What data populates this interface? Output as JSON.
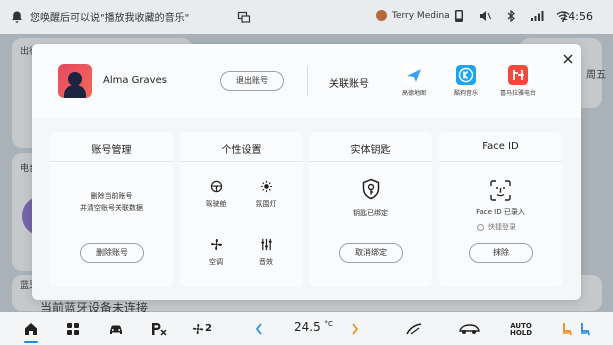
{
  "status_bar": {
    "voice_hint": "您唤醒后可以说\"播放我收藏的音乐\"",
    "user": "Terry Medina",
    "time": "14:56"
  },
  "background": {
    "left_label_1": "出行",
    "left_label_2": "电台",
    "left_label_3": "蓝牙",
    "right_label": "周五",
    "bottom_text": "当前蓝牙设备未连接"
  },
  "dialog": {
    "user_name": "Alma Graves",
    "logout_label": "退出账号",
    "linked_accounts_title": "关联账号",
    "linked_apps": [
      {
        "label": "高德地图",
        "icon": "amap-icon",
        "color": "#3aa0f0"
      },
      {
        "label": "酷狗音乐",
        "icon": "kugou-icon",
        "color": "#1aa5f0"
      },
      {
        "label": "喜马拉雅电台",
        "icon": "ximalaya-icon",
        "color": "#f04a3a"
      }
    ],
    "cards": {
      "account": {
        "title": "账号管理",
        "description_line1": "删除当前账号",
        "description_line2": "并清空账号关联数据",
        "button": "删除账号"
      },
      "personal": {
        "title": "个性设置",
        "features": [
          {
            "label": "驾驶舱",
            "icon": "steering-wheel-icon"
          },
          {
            "label": "氛围灯",
            "icon": "ambient-light-icon"
          },
          {
            "label": "空调",
            "icon": "fan-icon"
          },
          {
            "label": "音效",
            "icon": "equalizer-icon"
          }
        ]
      },
      "key": {
        "title": "实体钥匙",
        "status": "钥匙已绑定",
        "button": "取消绑定"
      },
      "face": {
        "title": "Face ID",
        "status": "Face ID 已录入",
        "quick_login": "快捷登录",
        "button": "抹除"
      }
    }
  },
  "dock": {
    "fan_level": "2",
    "temperature": "24.5",
    "temperature_unit": "°C",
    "auto_hold_line1": "AUTO",
    "auto_hold_line2": "HOLD"
  },
  "colors": {
    "accent": "#1e88e5",
    "dialog_bg": "#f4f6f7",
    "card_bg": "#fafbfc"
  }
}
